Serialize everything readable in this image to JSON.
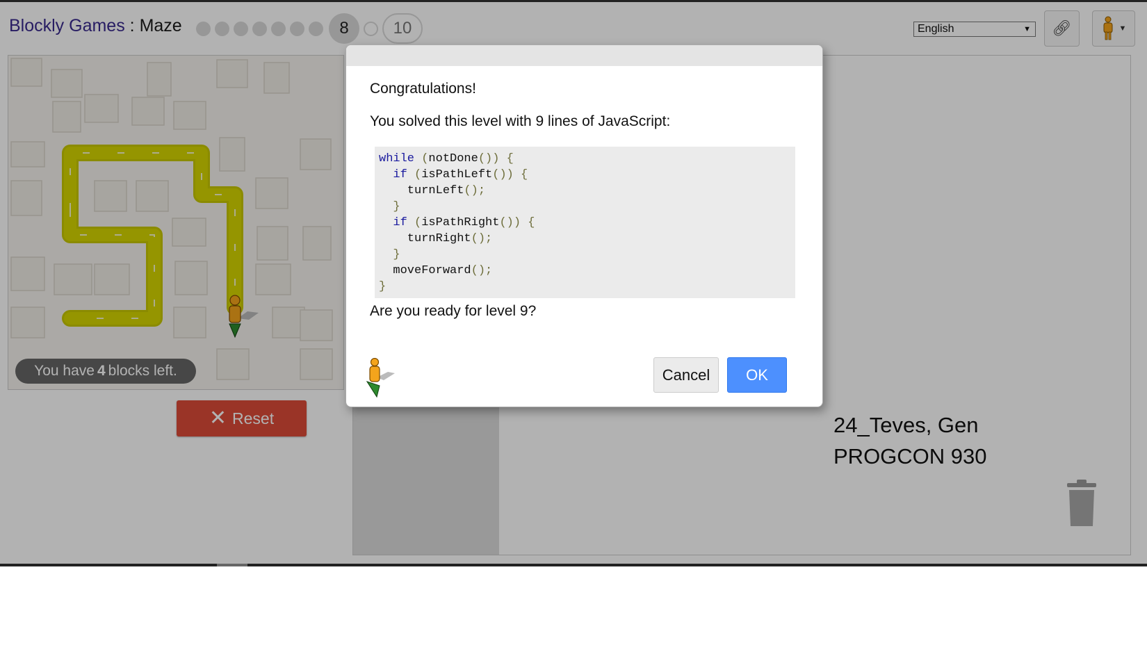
{
  "header": {
    "brand_link": "Blockly Games",
    "separator": " : ",
    "game_title": "Maze",
    "levels_completed": 7,
    "current_level": "8",
    "future_level": "10",
    "language": "English",
    "link_icon": "link-icon",
    "pegman_icon": "pegman-icon"
  },
  "maze": {
    "block_counter_prefix": "You have",
    "blocks_left": "4",
    "block_counter_suffix": "blocks left.",
    "reset_label": "Reset"
  },
  "dialog": {
    "title": "Congratulations!",
    "summary": "You solved this level with 9 lines of JavaScript:",
    "code_lines": [
      "while (notDone()) {",
      "  if (isPathLeft()) {",
      "    turnLeft();",
      "  }",
      "  if (isPathRight()) {",
      "    turnRight();",
      "  }",
      "  moveForward();",
      "}"
    ],
    "prompt": "Are you ready for level 9?",
    "cancel_label": "Cancel",
    "ok_label": "OK"
  },
  "watermark": {
    "line1": "24_Teves, Gen",
    "line2": "PROGCON 930"
  },
  "colors": {
    "path": "#d6d600",
    "reset": "#dd4b39",
    "ok": "#4d90fe",
    "brand": "#3a2a8f"
  }
}
